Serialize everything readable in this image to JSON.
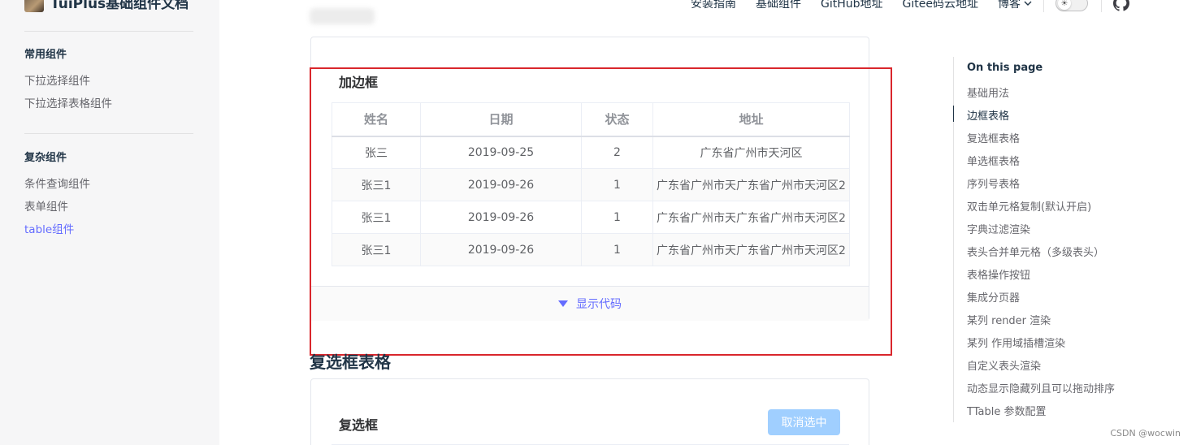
{
  "sidebar": {
    "brand_title": "TuiPlus基础组件文档",
    "groups": [
      {
        "title": "常用组件",
        "items": [
          {
            "label": "下拉选择组件"
          },
          {
            "label": "下拉选择表格组件"
          }
        ]
      },
      {
        "title": "复杂组件",
        "items": [
          {
            "label": "条件查询组件"
          },
          {
            "label": "表单组件"
          },
          {
            "label": "table组件",
            "active": true
          }
        ]
      }
    ]
  },
  "topnav": {
    "links": [
      "安装指南",
      "基础组件",
      "GitHub地址",
      "Gitee码云地址"
    ],
    "dropdown_label": "博客",
    "theme_icon": "sun-icon",
    "github_icon": "github-icon"
  },
  "demo1": {
    "title": "加边框",
    "columns": [
      "姓名",
      "日期",
      "状态",
      "地址"
    ],
    "rows": [
      [
        "张三",
        "2019-09-25",
        "2",
        "广东省广州市天河区"
      ],
      [
        "张三1",
        "2019-09-26",
        "1",
        "广东省广州市天广东省广州市天河区2"
      ],
      [
        "张三1",
        "2019-09-26",
        "1",
        "广东省广州市天广东省广州市天河区2"
      ],
      [
        "张三1",
        "2019-09-26",
        "1",
        "广东省广州市天广东省广州市天河区2"
      ]
    ],
    "show_code_label": "显示代码"
  },
  "section2": {
    "heading": "复选框表格",
    "card_title": "复选框",
    "deselect_button": "取消选中"
  },
  "toc": {
    "title": "On this page",
    "items": [
      "基础用法",
      "边框表格",
      "复选框表格",
      "单选框表格",
      "序列号表格",
      "双击单元格复制(默认开启)",
      "字典过滤渲染",
      "表头合并单元格（多级表头）",
      "表格操作按钮",
      "集成分页器",
      "某列 render 渲染",
      "某列 作用域插槽渲染",
      "自定义表头渲染",
      "动态显示隐藏列且可以拖动排序",
      "TTable 参数配置"
    ],
    "active_index": 1
  },
  "watermark": "CSDN @wocwin",
  "colors": {
    "accent": "#646cff",
    "annotation_box": "#d9262c",
    "disabled_button": "#a0cfff"
  }
}
